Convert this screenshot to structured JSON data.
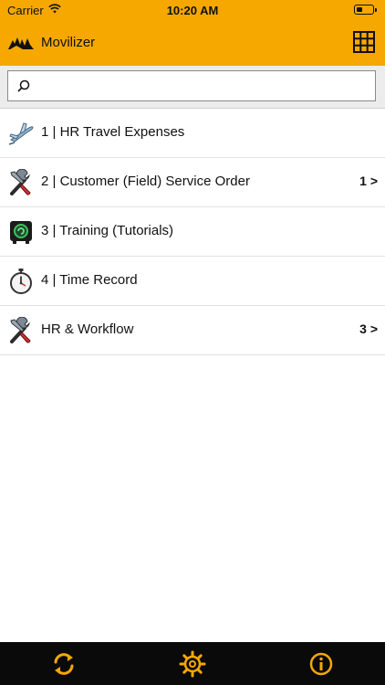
{
  "status_bar": {
    "carrier": "Carrier",
    "time": "10:20 AM",
    "signal_icon": "wifi-icon",
    "battery_icon": "battery-icon"
  },
  "header": {
    "title": "Movilizer",
    "logo_icon": "movilizer-logo-icon",
    "grid_icon": "grid-icon",
    "accent_color": "#f6a800"
  },
  "search": {
    "value": "",
    "placeholder": "",
    "icon": "search-icon"
  },
  "items": [
    {
      "label": "1 | HR Travel Expenses",
      "count": "",
      "icon": "airplane-icon"
    },
    {
      "label": "2 | Customer (Field) Service Order",
      "count": "1 >",
      "icon": "tools-icon"
    },
    {
      "label": "3 | Training (Tutorials)",
      "count": "",
      "icon": "training-icon"
    },
    {
      "label": "4 | Time Record",
      "count": "",
      "icon": "stopwatch-icon"
    },
    {
      "label": "HR & Workflow",
      "count": "3 >",
      "icon": "tools-icon"
    }
  ],
  "tabbar": {
    "sync_icon": "sync-icon",
    "settings_icon": "gear-icon",
    "info_icon": "info-icon",
    "icon_color": "#f6a800"
  }
}
